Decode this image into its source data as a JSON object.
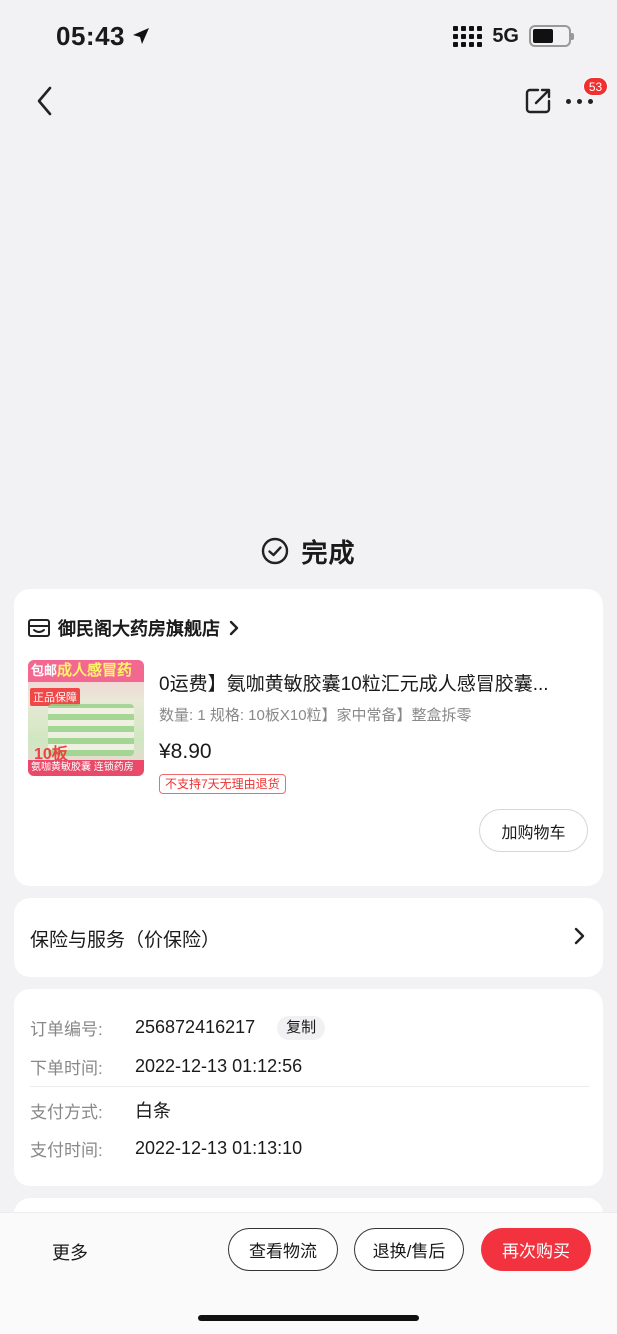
{
  "status_bar": {
    "time": "05:43",
    "network": "5G",
    "battery_level": 0.6
  },
  "nav": {
    "badge_count": "53"
  },
  "order_status": {
    "label": "完成"
  },
  "shop": {
    "name": "御民阁大药房旗舰店"
  },
  "product": {
    "thumbnail": {
      "top_text_small": "包邮",
      "top_text_big": "成人感冒药",
      "badge": "正品保障",
      "count": "10板",
      "bottom_text": "氨咖黄敏胶囊 连锁药房"
    },
    "title": "0运费】氨咖黄敏胶囊10粒汇元成人感冒胶囊...",
    "spec": "数量: 1   规格: 10板X10粒】家中常备】整盒拆零",
    "price": "¥8.90",
    "return_policy": "不支持7天无理由退货",
    "add_cart_label": "加购物车"
  },
  "insurance": {
    "label": "保险与服务（价保险）"
  },
  "order_info": {
    "rows": [
      {
        "key": "订单编号:",
        "value": "256872416217"
      },
      {
        "key": "下单时间:",
        "value": "2022-12-13 01:12:56"
      },
      {
        "key": "支付方式:",
        "value": "白条"
      },
      {
        "key": "支付时间:",
        "value": "2022-12-13 01:13:10"
      }
    ],
    "copy_label": "复制"
  },
  "bottom_bar": {
    "more": "更多",
    "logistics": "查看物流",
    "aftersale": "退换/售后",
    "rebuy": "再次购买"
  },
  "colors": {
    "accent": "#f2323e",
    "badge": "#f0302f",
    "page_bg": "#f2f2f4"
  }
}
